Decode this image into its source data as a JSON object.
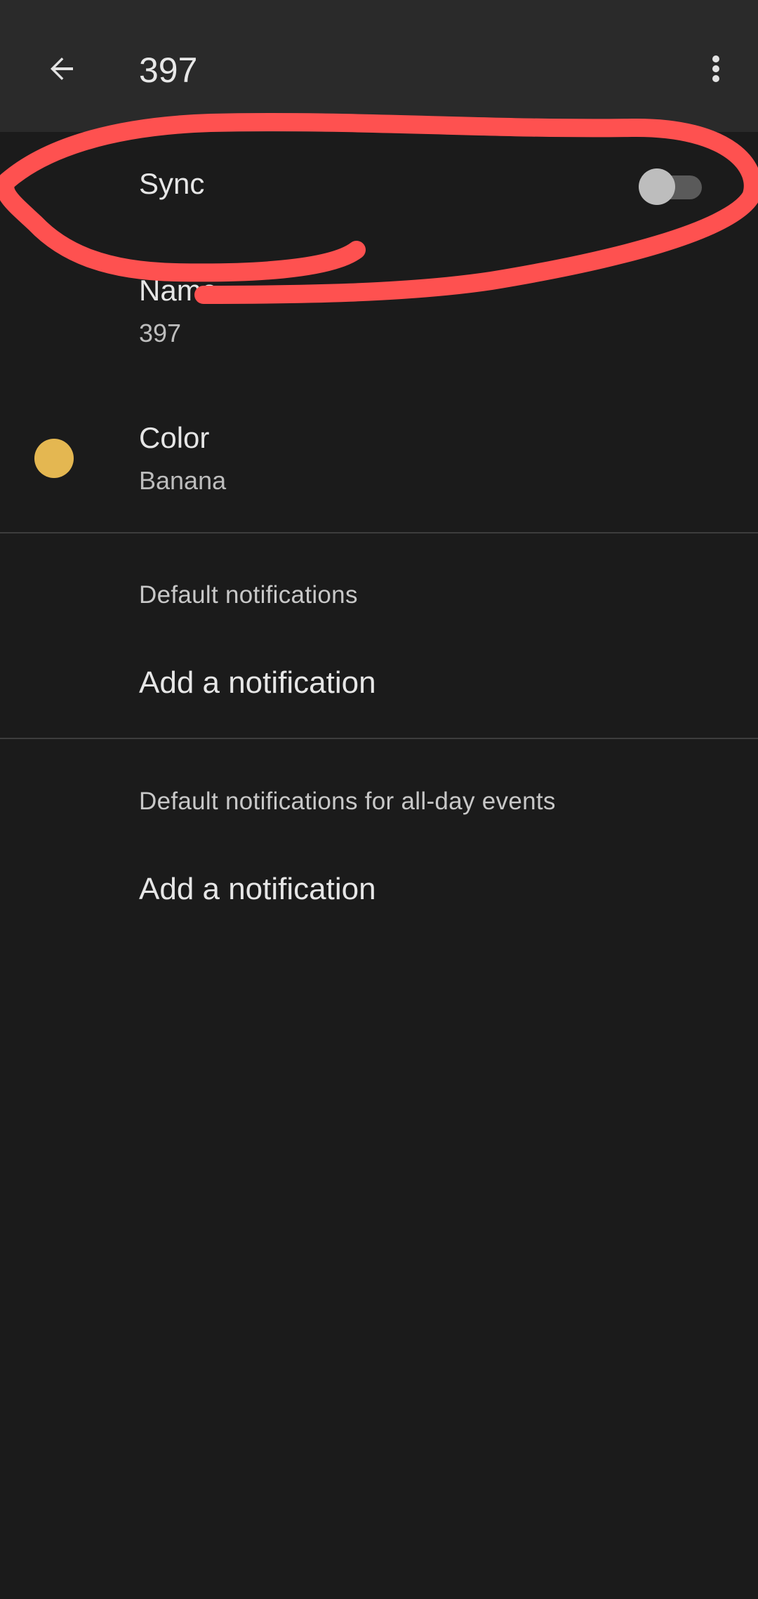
{
  "app_bar": {
    "title": "397",
    "back_icon": "arrow-back-icon",
    "more_icon": "more-vert-icon"
  },
  "sync": {
    "label": "Sync",
    "enabled": false
  },
  "name": {
    "label": "Name",
    "value": "397"
  },
  "color": {
    "label": "Color",
    "value": "Banana",
    "swatch": "#e4b751"
  },
  "default_notifications": {
    "header": "Default notifications",
    "add_label": "Add a notification"
  },
  "all_day_notifications": {
    "header": "Default notifications for all-day events",
    "add_label": "Add a notification"
  },
  "colors": {
    "background": "#1b1b1b",
    "app_bar": "#2a2a2a",
    "annotation_stroke": "#fe5150"
  }
}
